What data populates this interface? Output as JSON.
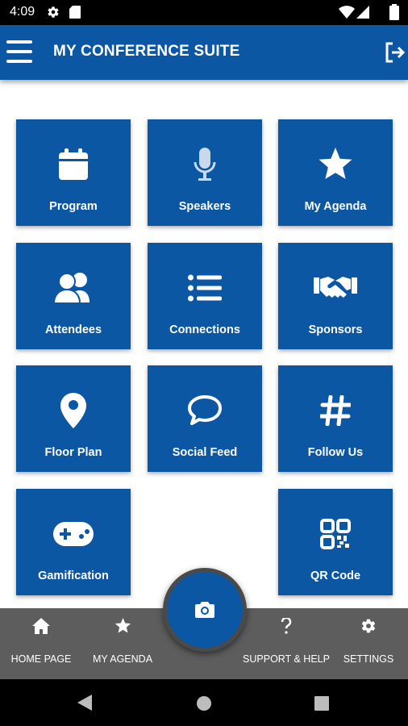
{
  "status_bar": {
    "time": "4:09"
  },
  "app_bar": {
    "title": "MY CONFERENCE SUITE"
  },
  "tiles": [
    {
      "label": "Program",
      "icon": "calendar-icon"
    },
    {
      "label": "Speakers",
      "icon": "microphone-icon"
    },
    {
      "label": "My Agenda",
      "icon": "star-icon"
    },
    {
      "label": "Attendees",
      "icon": "users-icon"
    },
    {
      "label": "Connections",
      "icon": "list-icon"
    },
    {
      "label": "Sponsors",
      "icon": "handshake-icon"
    },
    {
      "label": "Floor Plan",
      "icon": "map-pin-icon"
    },
    {
      "label": "Social Feed",
      "icon": "chat-bubble-icon"
    },
    {
      "label": "Follow Us",
      "icon": "hashtag-icon"
    },
    {
      "label": "Gamification",
      "icon": "gamepad-icon"
    },
    {
      "label": "QR Code",
      "icon": "qr-code-icon"
    }
  ],
  "bottom_nav": [
    {
      "label": "HOME PAGE",
      "icon": "home-icon"
    },
    {
      "label": "MY AGENDA",
      "icon": "star-icon"
    },
    {
      "label": "SUPPORT & HELP",
      "icon": "question-icon"
    },
    {
      "label": "SETTINGS",
      "icon": "gear-icon"
    }
  ],
  "camera_button": {
    "icon": "camera-icon"
  },
  "colors": {
    "primary": "#0b57a4",
    "bottom_nav": "#5d5d5d",
    "status_bar": "#000000"
  }
}
